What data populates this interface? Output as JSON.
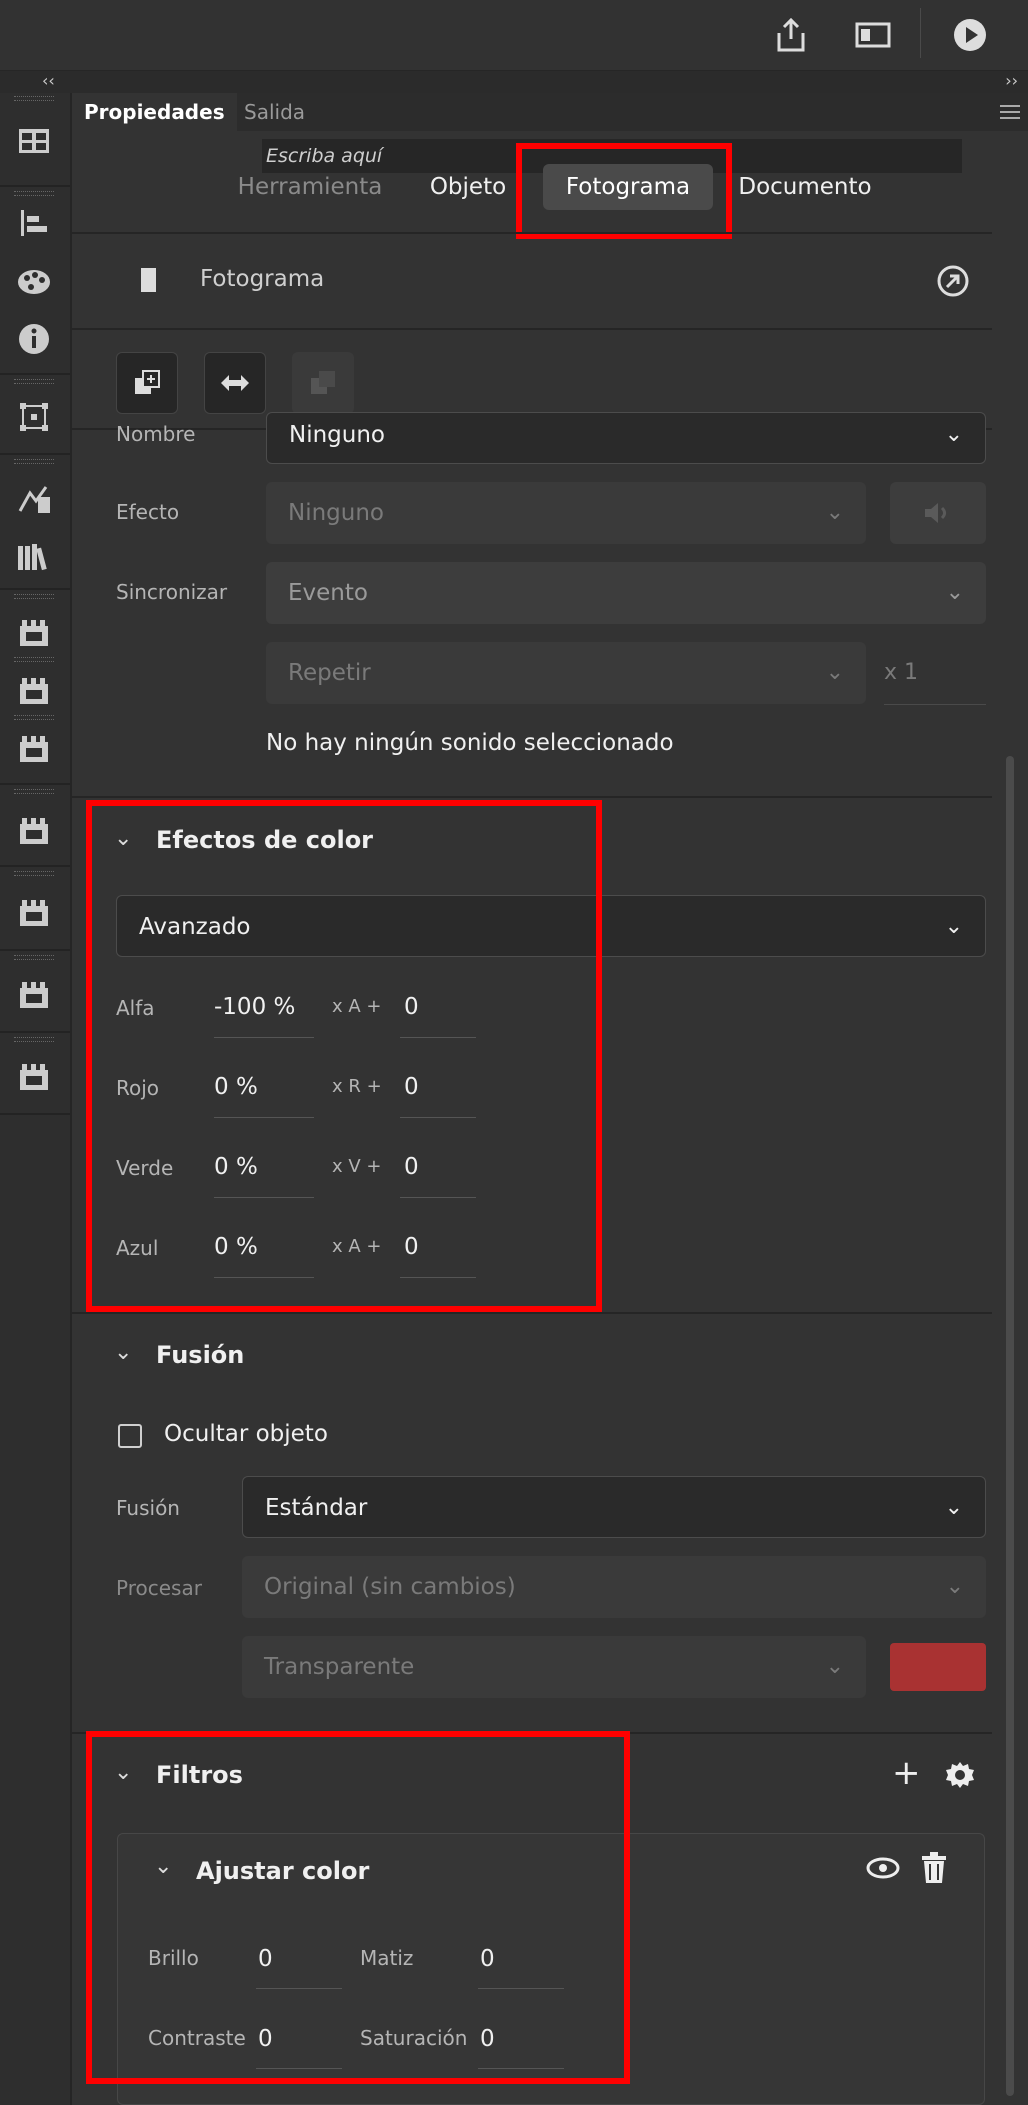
{
  "panel_tabs": {
    "properties": "Propiedades",
    "output": "Salida"
  },
  "search": {
    "placeholder": "Escriba aquí"
  },
  "segment_tabs": {
    "tool": "Herramienta",
    "object": "Objeto",
    "frame": "Fotograma",
    "document": "Documento"
  },
  "header": {
    "title": "Fotograma"
  },
  "sound": {
    "name_label": "Nombre",
    "name_value": "Ninguno",
    "effect_label": "Efecto",
    "effect_value": "Ninguno",
    "sync_label": "Sincronizar",
    "sync_value": "Evento",
    "repeat_value": "Repetir",
    "repeat_count": "x 1",
    "status": "No hay ningún sonido seleccionado"
  },
  "color_effects": {
    "title": "Efectos de color",
    "mode": "Avanzado",
    "rows": [
      {
        "label": "Alfa",
        "percent": "-100 %",
        "op": "x A +",
        "offset": "0"
      },
      {
        "label": "Rojo",
        "percent": "0 %",
        "op": "x R +",
        "offset": "0"
      },
      {
        "label": "Verde",
        "percent": "0 %",
        "op": "x V +",
        "offset": "0"
      },
      {
        "label": "Azul",
        "percent": "0 %",
        "op": "x A +",
        "offset": "0"
      }
    ]
  },
  "blend": {
    "title": "Fusión",
    "hide_object": "Ocultar objeto",
    "blend_label": "Fusión",
    "blend_value": "Estándar",
    "render_label": "Procesar",
    "render_value": "Original (sin cambios)",
    "transparent_value": "Transparente",
    "swatch_color": "#a93232"
  },
  "filters": {
    "title": "Filtros",
    "adjust_color": {
      "title": "Ajustar color",
      "brightness_label": "Brillo",
      "brightness_value": "0",
      "hue_label": "Matiz",
      "hue_value": "0",
      "contrast_label": "Contraste",
      "contrast_value": "0",
      "saturation_label": "Saturación",
      "saturation_value": "0"
    }
  },
  "colors": {
    "highlight": "#ff0000",
    "background": "#333333"
  }
}
